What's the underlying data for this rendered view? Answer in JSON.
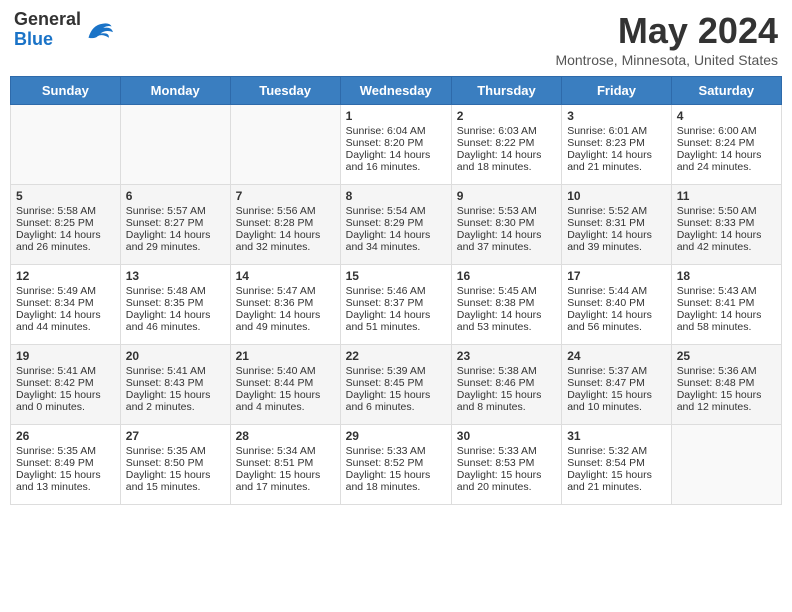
{
  "header": {
    "logo_general": "General",
    "logo_blue": "Blue",
    "month_title": "May 2024",
    "subtitle": "Montrose, Minnesota, United States"
  },
  "days_of_week": [
    "Sunday",
    "Monday",
    "Tuesday",
    "Wednesday",
    "Thursday",
    "Friday",
    "Saturday"
  ],
  "weeks": [
    [
      {
        "day": "",
        "sunrise": "",
        "sunset": "",
        "daylight": ""
      },
      {
        "day": "",
        "sunrise": "",
        "sunset": "",
        "daylight": ""
      },
      {
        "day": "",
        "sunrise": "",
        "sunset": "",
        "daylight": ""
      },
      {
        "day": "1",
        "sunrise": "Sunrise: 6:04 AM",
        "sunset": "Sunset: 8:20 PM",
        "daylight": "Daylight: 14 hours and 16 minutes."
      },
      {
        "day": "2",
        "sunrise": "Sunrise: 6:03 AM",
        "sunset": "Sunset: 8:22 PM",
        "daylight": "Daylight: 14 hours and 18 minutes."
      },
      {
        "day": "3",
        "sunrise": "Sunrise: 6:01 AM",
        "sunset": "Sunset: 8:23 PM",
        "daylight": "Daylight: 14 hours and 21 minutes."
      },
      {
        "day": "4",
        "sunrise": "Sunrise: 6:00 AM",
        "sunset": "Sunset: 8:24 PM",
        "daylight": "Daylight: 14 hours and 24 minutes."
      }
    ],
    [
      {
        "day": "5",
        "sunrise": "Sunrise: 5:58 AM",
        "sunset": "Sunset: 8:25 PM",
        "daylight": "Daylight: 14 hours and 26 minutes."
      },
      {
        "day": "6",
        "sunrise": "Sunrise: 5:57 AM",
        "sunset": "Sunset: 8:27 PM",
        "daylight": "Daylight: 14 hours and 29 minutes."
      },
      {
        "day": "7",
        "sunrise": "Sunrise: 5:56 AM",
        "sunset": "Sunset: 8:28 PM",
        "daylight": "Daylight: 14 hours and 32 minutes."
      },
      {
        "day": "8",
        "sunrise": "Sunrise: 5:54 AM",
        "sunset": "Sunset: 8:29 PM",
        "daylight": "Daylight: 14 hours and 34 minutes."
      },
      {
        "day": "9",
        "sunrise": "Sunrise: 5:53 AM",
        "sunset": "Sunset: 8:30 PM",
        "daylight": "Daylight: 14 hours and 37 minutes."
      },
      {
        "day": "10",
        "sunrise": "Sunrise: 5:52 AM",
        "sunset": "Sunset: 8:31 PM",
        "daylight": "Daylight: 14 hours and 39 minutes."
      },
      {
        "day": "11",
        "sunrise": "Sunrise: 5:50 AM",
        "sunset": "Sunset: 8:33 PM",
        "daylight": "Daylight: 14 hours and 42 minutes."
      }
    ],
    [
      {
        "day": "12",
        "sunrise": "Sunrise: 5:49 AM",
        "sunset": "Sunset: 8:34 PM",
        "daylight": "Daylight: 14 hours and 44 minutes."
      },
      {
        "day": "13",
        "sunrise": "Sunrise: 5:48 AM",
        "sunset": "Sunset: 8:35 PM",
        "daylight": "Daylight: 14 hours and 46 minutes."
      },
      {
        "day": "14",
        "sunrise": "Sunrise: 5:47 AM",
        "sunset": "Sunset: 8:36 PM",
        "daylight": "Daylight: 14 hours and 49 minutes."
      },
      {
        "day": "15",
        "sunrise": "Sunrise: 5:46 AM",
        "sunset": "Sunset: 8:37 PM",
        "daylight": "Daylight: 14 hours and 51 minutes."
      },
      {
        "day": "16",
        "sunrise": "Sunrise: 5:45 AM",
        "sunset": "Sunset: 8:38 PM",
        "daylight": "Daylight: 14 hours and 53 minutes."
      },
      {
        "day": "17",
        "sunrise": "Sunrise: 5:44 AM",
        "sunset": "Sunset: 8:40 PM",
        "daylight": "Daylight: 14 hours and 56 minutes."
      },
      {
        "day": "18",
        "sunrise": "Sunrise: 5:43 AM",
        "sunset": "Sunset: 8:41 PM",
        "daylight": "Daylight: 14 hours and 58 minutes."
      }
    ],
    [
      {
        "day": "19",
        "sunrise": "Sunrise: 5:41 AM",
        "sunset": "Sunset: 8:42 PM",
        "daylight": "Daylight: 15 hours and 0 minutes."
      },
      {
        "day": "20",
        "sunrise": "Sunrise: 5:41 AM",
        "sunset": "Sunset: 8:43 PM",
        "daylight": "Daylight: 15 hours and 2 minutes."
      },
      {
        "day": "21",
        "sunrise": "Sunrise: 5:40 AM",
        "sunset": "Sunset: 8:44 PM",
        "daylight": "Daylight: 15 hours and 4 minutes."
      },
      {
        "day": "22",
        "sunrise": "Sunrise: 5:39 AM",
        "sunset": "Sunset: 8:45 PM",
        "daylight": "Daylight: 15 hours and 6 minutes."
      },
      {
        "day": "23",
        "sunrise": "Sunrise: 5:38 AM",
        "sunset": "Sunset: 8:46 PM",
        "daylight": "Daylight: 15 hours and 8 minutes."
      },
      {
        "day": "24",
        "sunrise": "Sunrise: 5:37 AM",
        "sunset": "Sunset: 8:47 PM",
        "daylight": "Daylight: 15 hours and 10 minutes."
      },
      {
        "day": "25",
        "sunrise": "Sunrise: 5:36 AM",
        "sunset": "Sunset: 8:48 PM",
        "daylight": "Daylight: 15 hours and 12 minutes."
      }
    ],
    [
      {
        "day": "26",
        "sunrise": "Sunrise: 5:35 AM",
        "sunset": "Sunset: 8:49 PM",
        "daylight": "Daylight: 15 hours and 13 minutes."
      },
      {
        "day": "27",
        "sunrise": "Sunrise: 5:35 AM",
        "sunset": "Sunset: 8:50 PM",
        "daylight": "Daylight: 15 hours and 15 minutes."
      },
      {
        "day": "28",
        "sunrise": "Sunrise: 5:34 AM",
        "sunset": "Sunset: 8:51 PM",
        "daylight": "Daylight: 15 hours and 17 minutes."
      },
      {
        "day": "29",
        "sunrise": "Sunrise: 5:33 AM",
        "sunset": "Sunset: 8:52 PM",
        "daylight": "Daylight: 15 hours and 18 minutes."
      },
      {
        "day": "30",
        "sunrise": "Sunrise: 5:33 AM",
        "sunset": "Sunset: 8:53 PM",
        "daylight": "Daylight: 15 hours and 20 minutes."
      },
      {
        "day": "31",
        "sunrise": "Sunrise: 5:32 AM",
        "sunset": "Sunset: 8:54 PM",
        "daylight": "Daylight: 15 hours and 21 minutes."
      },
      {
        "day": "",
        "sunrise": "",
        "sunset": "",
        "daylight": ""
      }
    ]
  ]
}
